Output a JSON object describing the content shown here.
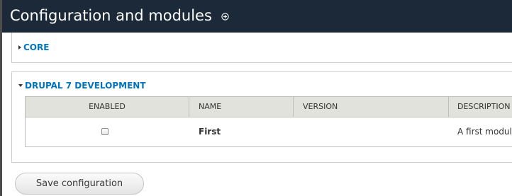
{
  "page": {
    "title": "Configuration and modules"
  },
  "colors": {
    "header_bg": "#1c2938",
    "legend_link": "#0074bd",
    "table_header_bg": "#e1e2dc"
  },
  "icons": {
    "title_icon": "plus-circle-icon",
    "core_toggle": "triangle-right-icon",
    "dev_toggle": "triangle-down-icon"
  },
  "fieldsets": {
    "core": {
      "legend": "CORE",
      "collapsed": true
    },
    "dev": {
      "legend": "DRUPAL 7 DEVELOPMENT",
      "collapsed": false
    }
  },
  "table": {
    "headers": {
      "enabled": "ENABLED",
      "name": "NAME",
      "version": "VERSION",
      "description": "DESCRIPTION"
    },
    "rows": [
      {
        "enabled": false,
        "name": "First",
        "version": "",
        "description": "A first module."
      }
    ]
  },
  "actions": {
    "save_label": "Save configuration"
  }
}
